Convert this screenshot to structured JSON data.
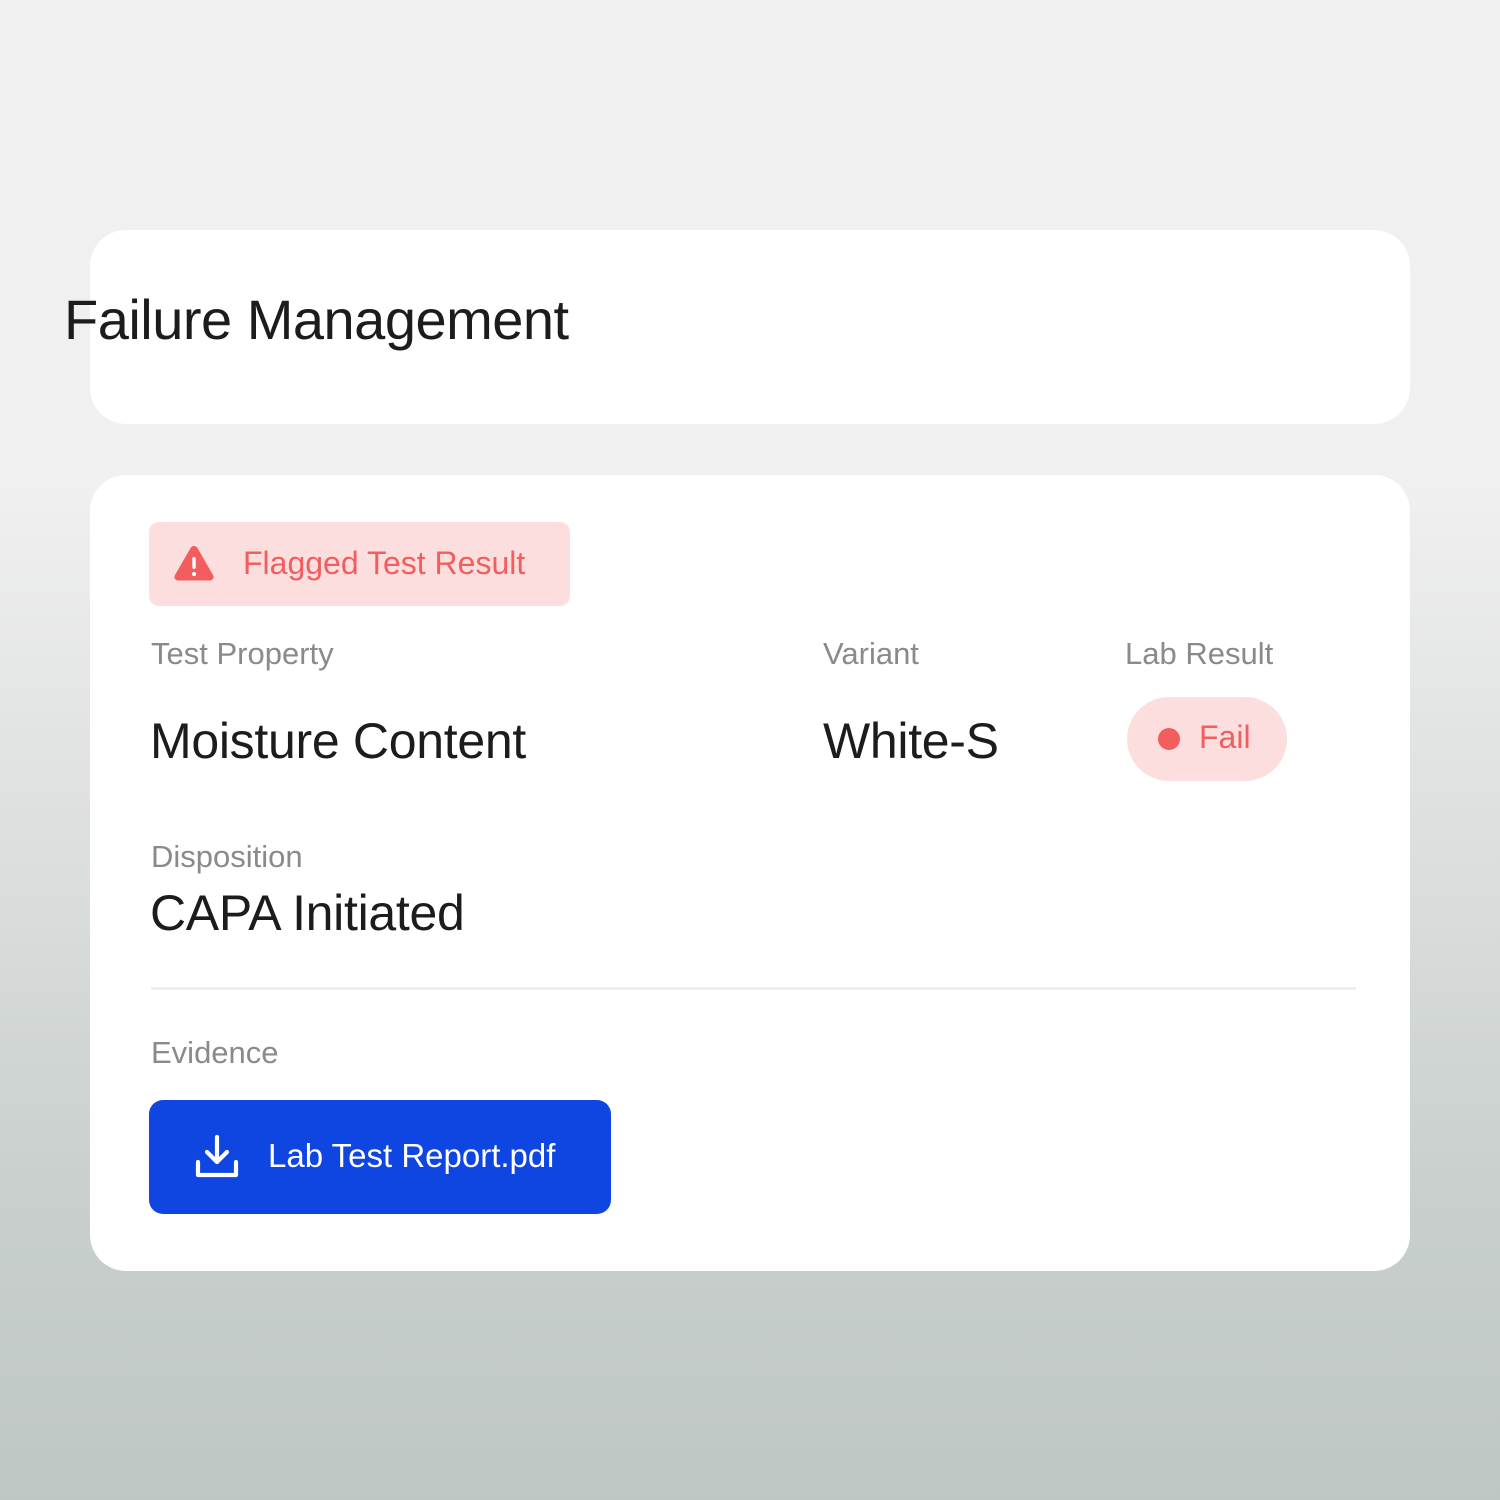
{
  "header": {
    "title": "Failure Management"
  },
  "flag": {
    "label": "Flagged Test Result",
    "icon": "warning-triangle-icon",
    "color": "#f25e5e",
    "background": "#fcdede"
  },
  "fields": {
    "test_property": {
      "label": "Test Property",
      "value": "Moisture Content"
    },
    "variant": {
      "label": "Variant",
      "value": "White-S"
    },
    "lab_result": {
      "label": "Lab Result",
      "value": "Fail",
      "status_color": "#f25e5e"
    },
    "disposition": {
      "label": "Disposition",
      "value": "CAPA Initiated"
    }
  },
  "evidence": {
    "label": "Evidence",
    "file_label": "Lab Test Report.pdf",
    "icon": "download-icon",
    "button_color": "#0f45e0"
  }
}
